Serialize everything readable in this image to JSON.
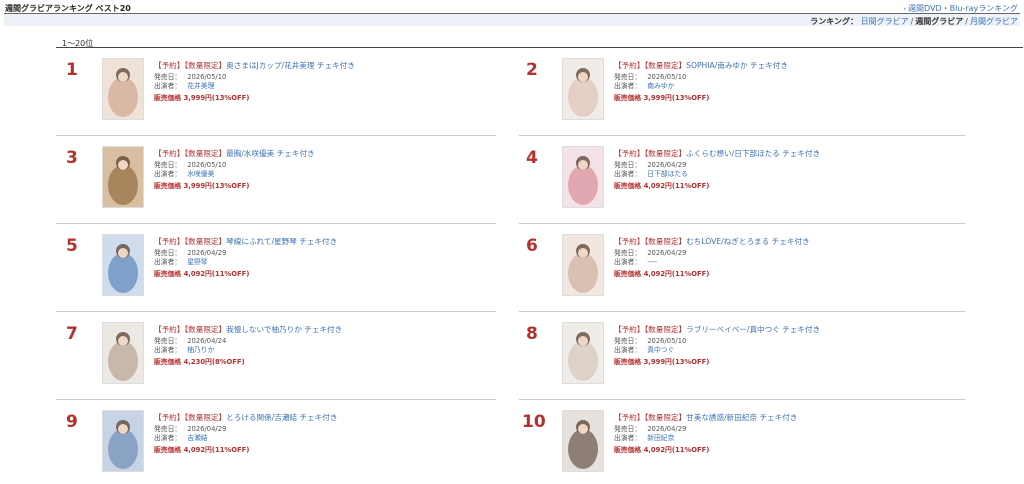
{
  "header": {
    "title": "週間グラビアランキング ベスト20",
    "dvd_link": "週間DVD・Blu-rayランキング"
  },
  "ranking_nav": {
    "label": "ランキング：",
    "daily": "日間グラビア",
    "weekly": "週間グラビア",
    "monthly": "月間グラビア",
    "sep": "/"
  },
  "range_label": "1〜20位",
  "field_labels": {
    "release": "発売日：",
    "performer": "出演者：",
    "price": "販売価格"
  },
  "items": [
    {
      "rank": "1",
      "tag": "【予約】【数量限定】",
      "title": "奥さまはJカップ/花井美理 チェキ付き",
      "date": "2026/05/10",
      "performer": "花井美理",
      "price": "3,999円(13%OFF)"
    },
    {
      "rank": "2",
      "tag": "【予約】【数量限定】",
      "title": "SOPHIA/南みゆか チェキ付き",
      "date": "2026/05/10",
      "performer": "南みゆか",
      "price": "3,999円(13%OFF)"
    },
    {
      "rank": "3",
      "tag": "【予約】【数量限定】",
      "title": "最胸/水咲優美 チェキ付き",
      "date": "2026/05/10",
      "performer": "水咲優美",
      "price": "3,999円(13%OFF)"
    },
    {
      "rank": "4",
      "tag": "【予約】【数量限定】",
      "title": "ふくらむ想い/日下部ほたる チェキ付き",
      "date": "2026/04/29",
      "performer": "日下部ほたる",
      "price": "4,092円(11%OFF)"
    },
    {
      "rank": "5",
      "tag": "【予約】【数量限定】",
      "title": "琴線にふれて/星野琴 チェキ付き",
      "date": "2026/04/29",
      "performer": "星野琴",
      "price": "4,092円(11%OFF)"
    },
    {
      "rank": "6",
      "tag": "【予約】【数量限定】",
      "title": "むちLOVE/ねぎとろまる チェキ付き",
      "date": "2026/04/29",
      "performer": "----",
      "price": "4,092円(11%OFF)"
    },
    {
      "rank": "7",
      "tag": "【予約】【数量限定】",
      "title": "我慢しないで柚乃りか チェキ付き",
      "date": "2026/04/24",
      "performer": "柚乃りか",
      "price": "4,230円(8%OFF)"
    },
    {
      "rank": "8",
      "tag": "【予約】【数量限定】",
      "title": "ラブリーベイベー/真中つぐ チェキ付き",
      "date": "2026/05/10",
      "performer": "真中つぐ",
      "price": "3,999円(13%OFF)"
    },
    {
      "rank": "9",
      "tag": "【予約】【数量限定】",
      "title": "とろける関係/吉瀬結 チェキ付き",
      "date": "2026/04/29",
      "performer": "吉瀬結",
      "price": "4,092円(11%OFF)"
    },
    {
      "rank": "10",
      "tag": "【予約】【数量限定】",
      "title": "甘美な誘惑/新田紀奈 チェキ付き",
      "date": "2026/04/29",
      "performer": "新田紀奈",
      "price": "4,092円(11%OFF)"
    }
  ],
  "colors": {
    "accent_red": "#b5312f",
    "link_blue": "#3c72b8",
    "nav_bg": "#eef1f7"
  }
}
